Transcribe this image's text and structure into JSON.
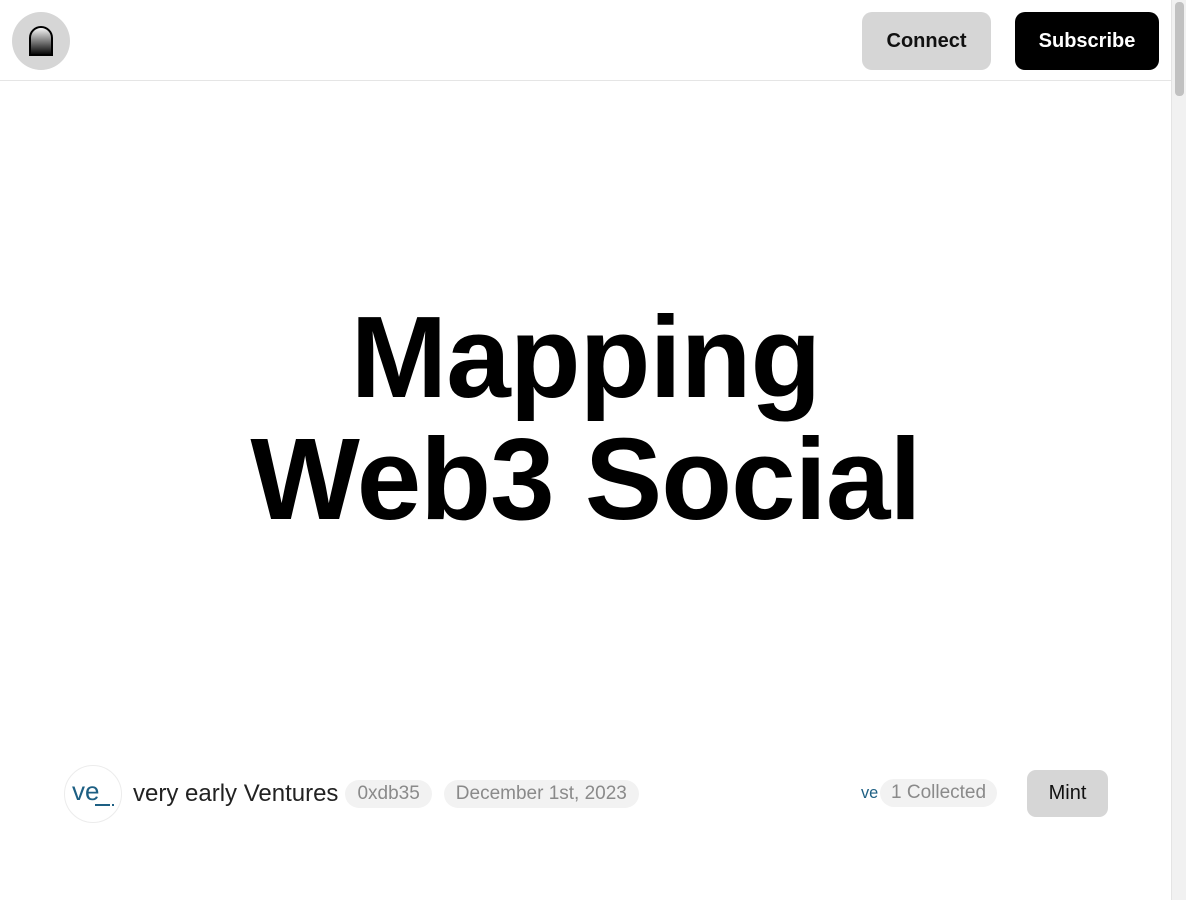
{
  "header": {
    "logo_icon": "arch-door-icon",
    "connect_label": "Connect",
    "subscribe_label": "Subscribe"
  },
  "article": {
    "title_line_1": "Mapping",
    "title_line_2": "Web3 Social"
  },
  "byline": {
    "author_avatar_text": "ve",
    "author_name": "very early Ventures",
    "address": "0xdb35",
    "date": "December 1st, 2023"
  },
  "collect": {
    "collector_avatar_text": "ve",
    "collected_text": "1 Collected",
    "mint_label": "Mint"
  },
  "colors": {
    "primary_button": "#000000",
    "secondary_button": "#d6d6d6",
    "pill_bg": "#f2f2f2",
    "brand_teal": "#1d5f83"
  }
}
